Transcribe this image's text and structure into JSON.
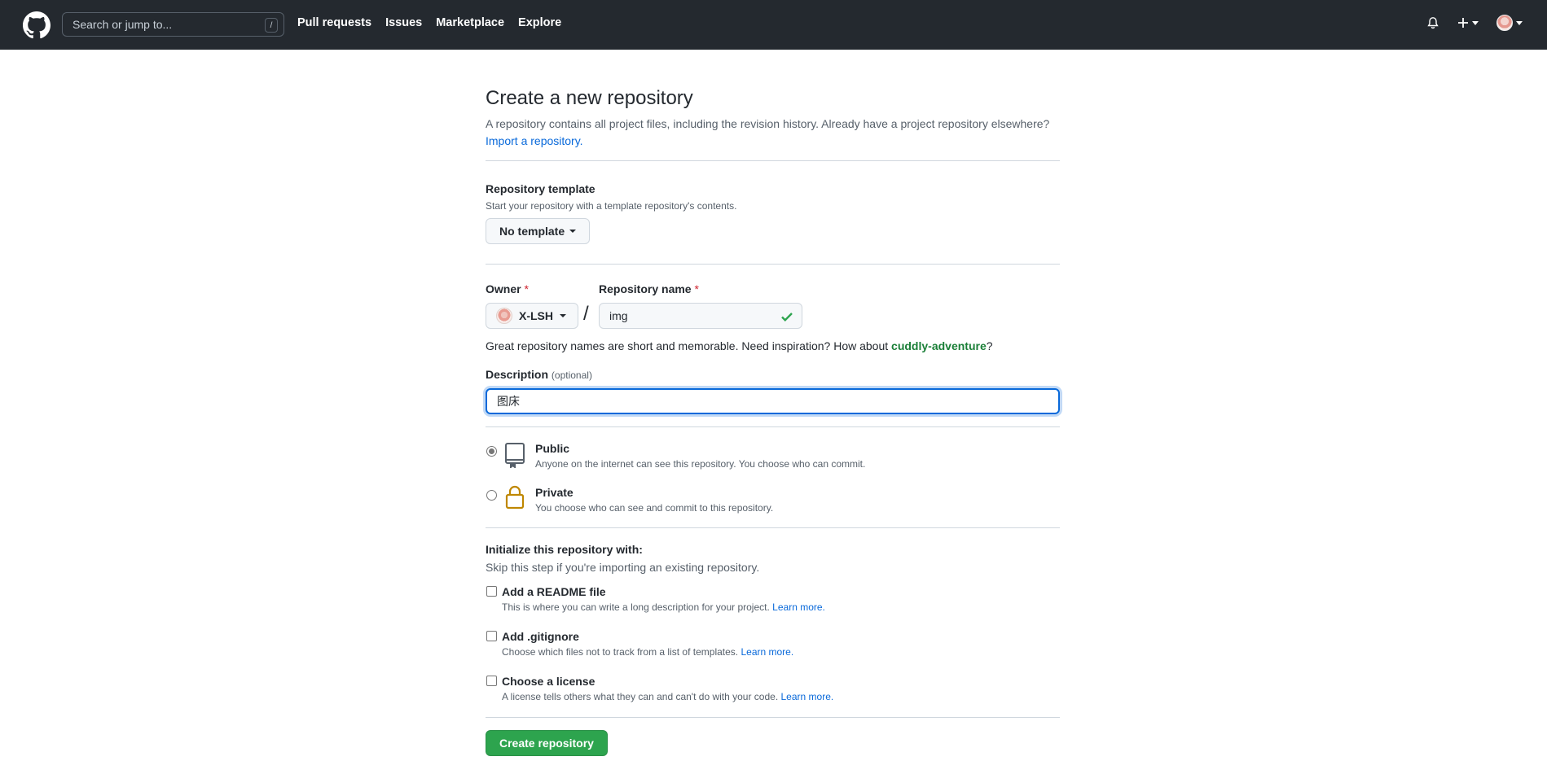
{
  "header": {
    "search_placeholder": "Search or jump to...",
    "search_shortcut": "/",
    "nav": [
      "Pull requests",
      "Issues",
      "Marketplace",
      "Explore"
    ],
    "icons": [
      "github-logo-icon",
      "bell-icon",
      "plus-icon",
      "avatar"
    ]
  },
  "page": {
    "title": "Create a new repository",
    "subtitle": "A repository contains all project files, including the revision history. Already have a project repository elsewhere?",
    "import_link": "Import a repository."
  },
  "template": {
    "label": "Repository template",
    "sub": "Start your repository with a template repository's contents.",
    "button": "No template"
  },
  "owner": {
    "label": "Owner",
    "required": "*",
    "value": "X-LSH",
    "separator": "/"
  },
  "repo_name": {
    "label": "Repository name",
    "required": "*",
    "value": "img"
  },
  "suggestion": {
    "text": "Great repository names are short and memorable. Need inspiration? How about",
    "name": "cuddly-adventure",
    "end": "?"
  },
  "description": {
    "label": "Description",
    "optional": "(optional)",
    "value": "图床"
  },
  "visibility": {
    "public": {
      "title": "Public",
      "desc": "Anyone on the internet can see this repository. You choose who can commit.",
      "selected": true
    },
    "private": {
      "title": "Private",
      "desc": "You choose who can see and commit to this repository.",
      "selected": false
    }
  },
  "init": {
    "title": "Initialize this repository with:",
    "sub": "Skip this step if you're importing an existing repository.",
    "readme": {
      "title": "Add a README file",
      "desc": "This is where you can write a long description for your project.",
      "link": "Learn more."
    },
    "gitignore": {
      "title": "Add .gitignore",
      "desc": "Choose which files not to track from a list of templates.",
      "link": "Learn more."
    },
    "license": {
      "title": "Choose a license",
      "desc": "A license tells others what they can and can't do with your code.",
      "link": "Learn more."
    }
  },
  "submit": {
    "label": "Create repository"
  },
  "colors": {
    "header_bg": "#24292f",
    "link": "#0969da",
    "success": "#2da44e",
    "suggestion": "#1a7f37",
    "focus": "#0969da"
  }
}
